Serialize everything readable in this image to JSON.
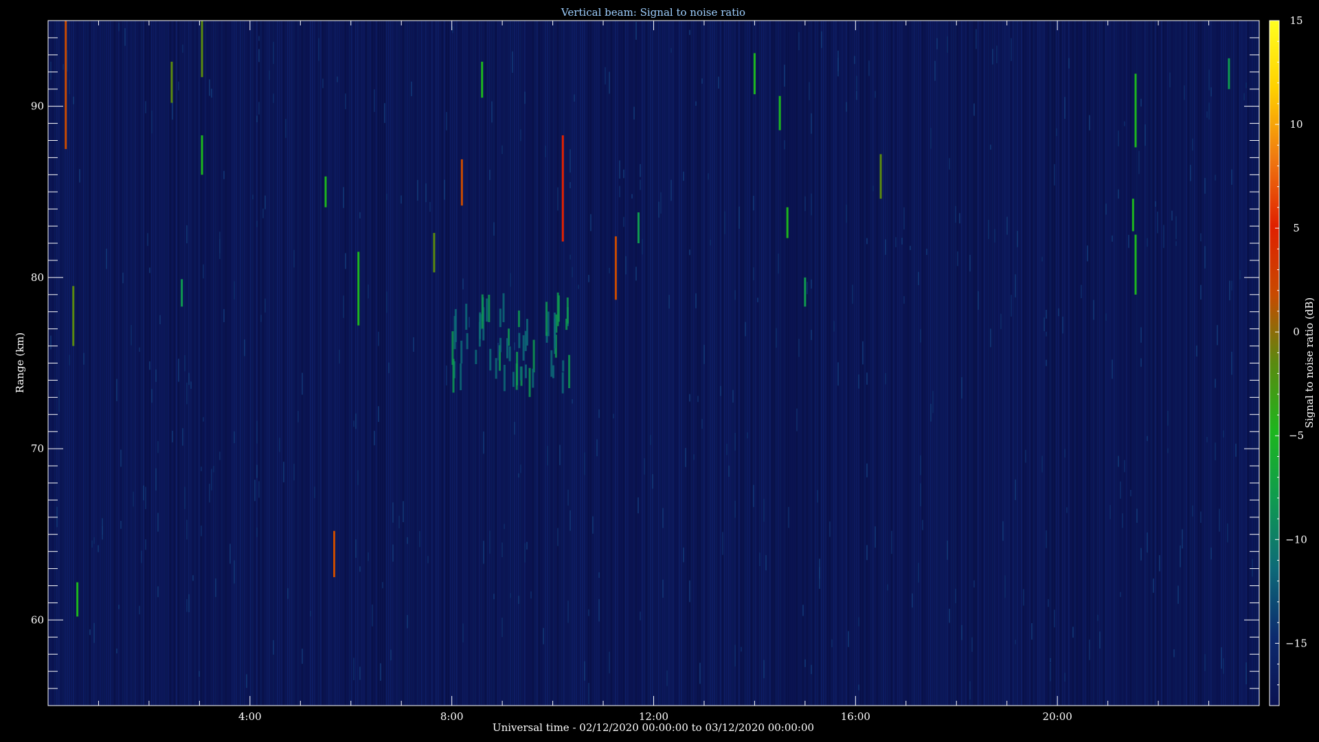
{
  "chart_data": {
    "type": "heatmap",
    "title": "Vertical beam: Signal to noise ratio",
    "xlabel": "Universal time - 02/12/2020 00:00:00 to 03/12/2020 00:00:00",
    "ylabel": "Range (km)",
    "colorbar_label": "Signal to noise ratio (dB)",
    "xlim": [
      0,
      24
    ],
    "ylim": [
      55,
      95
    ],
    "clim": [
      -18,
      15
    ],
    "x_ticks": [
      4,
      8,
      12,
      16,
      20
    ],
    "x_tick_labels": [
      "4:00",
      "8:00",
      "12:00",
      "16:00",
      "20:00"
    ],
    "y_ticks": [
      60,
      70,
      80,
      90
    ],
    "y_tick_labels": [
      "60",
      "70",
      "80",
      "90"
    ],
    "colorbar_ticks": [
      15,
      10,
      5,
      0,
      -5,
      -10,
      -15
    ],
    "colorbar_tick_labels": [
      "15",
      "10",
      "5",
      "0",
      "−5",
      "−10",
      "−15"
    ],
    "background_snr_db": -15,
    "colormap": [
      "#0a1252",
      "#0c2a6e",
      "#0d6a78",
      "#0f9a50",
      "#1db61e",
      "#5a8a10",
      "#c84a00",
      "#e02000",
      "#f07a10",
      "#ffd000",
      "#ffff20"
    ],
    "features": [
      {
        "t": 0.35,
        "r0": 87.5,
        "r1": 95.0,
        "snr": 3
      },
      {
        "t": 0.5,
        "r0": 76.0,
        "r1": 79.5,
        "snr": 0
      },
      {
        "t": 0.58,
        "r0": 60.2,
        "r1": 62.2,
        "snr": -6
      },
      {
        "t": 2.45,
        "r0": 90.2,
        "r1": 92.6,
        "snr": -2
      },
      {
        "t": 2.65,
        "r0": 78.3,
        "r1": 79.9,
        "snr": -8
      },
      {
        "t": 3.05,
        "r0": 91.7,
        "r1": 95.0,
        "snr": -3
      },
      {
        "t": 3.05,
        "r0": 86.0,
        "r1": 88.3,
        "snr": -6
      },
      {
        "t": 5.5,
        "r0": 84.1,
        "r1": 85.9,
        "snr": -6
      },
      {
        "t": 5.67,
        "r0": 62.5,
        "r1": 65.2,
        "snr": 2
      },
      {
        "t": 6.15,
        "r0": 77.2,
        "r1": 81.5,
        "snr": -6
      },
      {
        "t": 7.65,
        "r0": 80.3,
        "r1": 82.6,
        "snr": -3
      },
      {
        "t": 8.2,
        "r0": 84.2,
        "r1": 86.9,
        "snr": 2
      },
      {
        "t": 8.6,
        "r0": 90.5,
        "r1": 92.6,
        "snr": -6
      },
      {
        "t": 10.2,
        "r0": 82.1,
        "r1": 88.3,
        "snr": 4
      },
      {
        "t": 11.25,
        "r0": 78.7,
        "r1": 82.4,
        "snr": 2
      },
      {
        "t": 11.7,
        "r0": 82.0,
        "r1": 83.8,
        "snr": -7
      },
      {
        "t": 14.0,
        "r0": 90.7,
        "r1": 93.1,
        "snr": -6
      },
      {
        "t": 14.5,
        "r0": 88.6,
        "r1": 90.6,
        "snr": -6
      },
      {
        "t": 14.65,
        "r0": 82.3,
        "r1": 84.1,
        "snr": -6
      },
      {
        "t": 15.0,
        "r0": 78.3,
        "r1": 80.0,
        "snr": -8
      },
      {
        "t": 16.5,
        "r0": 84.6,
        "r1": 87.2,
        "snr": -3
      },
      {
        "t": 21.5,
        "r0": 82.7,
        "r1": 84.6,
        "snr": -6
      },
      {
        "t": 21.55,
        "r0": 87.6,
        "r1": 91.9,
        "snr": -6
      },
      {
        "t": 21.55,
        "r0": 79.0,
        "r1": 82.5,
        "snr": -6
      },
      {
        "t": 23.4,
        "r0": 91.0,
        "r1": 92.8,
        "snr": -7
      }
    ],
    "cluster": {
      "t0": 8.0,
      "t1": 10.4,
      "r0": 72.8,
      "r1": 78.8,
      "snr": -8
    }
  }
}
